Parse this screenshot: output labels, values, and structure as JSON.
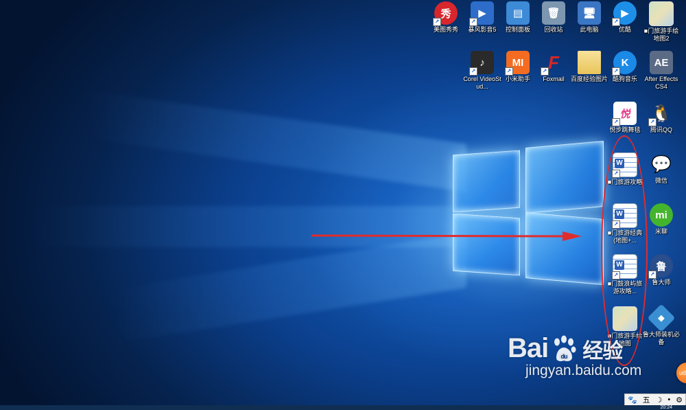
{
  "desktop": {
    "icons": [
      {
        "label": "美图秀秀",
        "glyph": "秀",
        "icon": "meitu-icon",
        "color": "#d7262c"
      },
      {
        "label": "暴风影音5",
        "glyph": "▶",
        "icon": "baofeng-icon",
        "color": "#2d6cc9"
      },
      {
        "label": "控制面板",
        "glyph": "▤",
        "icon": "control-panel-icon",
        "color": "#3d8ad6"
      },
      {
        "label": "回收站",
        "glyph": "🗑",
        "icon": "recycle-bin-icon",
        "color": "#7e97b0"
      },
      {
        "label": "此电脑",
        "glyph": "🖥",
        "icon": "this-pc-icon",
        "color": "#3a76c4"
      },
      {
        "label": "优酷",
        "glyph": "▶",
        "icon": "youku-icon",
        "color": "#1e8fe8"
      },
      {
        "label": "■门旅游手绘地图2",
        "glyph": "",
        "icon": "map-image-icon",
        "color": "#cfe3c5"
      },
      {
        "label": "Corel VideoStud...",
        "glyph": "♪",
        "icon": "corel-videostudio-icon",
        "color": "#2a2a2a"
      },
      {
        "label": "小米助手",
        "glyph": "MI",
        "icon": "xiaomi-assistant-icon",
        "color": "#f36c21"
      },
      {
        "label": "Foxmail",
        "glyph": "F",
        "icon": "foxmail-icon",
        "color": "#d92626"
      },
      {
        "label": "百度经验图片",
        "glyph": "",
        "icon": "folder-icon",
        "color": "#f4d77a"
      },
      {
        "label": "酷狗音乐",
        "glyph": "K",
        "icon": "kugou-icon",
        "color": "#1b8ae6"
      },
      {
        "label": "After Effects CS4",
        "glyph": "AE",
        "icon": "after-effects-icon",
        "color": "#5b6b86"
      },
      {
        "label": "悦步跳舞毯",
        "glyph": "悦",
        "icon": "dance-mat-icon",
        "color": "#e23d8a"
      },
      {
        "label": "腾讯QQ",
        "glyph": "🐧",
        "icon": "qq-icon",
        "color": "#1f1f1f"
      },
      {
        "label": "■门旅游攻略",
        "glyph": "W",
        "icon": "word-document-icon",
        "color": "#2b5fb3"
      },
      {
        "label": "微信",
        "glyph": "💬",
        "icon": "wechat-icon",
        "color": "#3fb53f"
      },
      {
        "label": "■门旅游经典(地图+...",
        "glyph": "W",
        "icon": "word-document-icon",
        "color": "#2b5fb3"
      },
      {
        "label": "米聊",
        "glyph": "mi",
        "icon": "miliao-icon",
        "color": "#45b42d"
      },
      {
        "label": "■门鼓浪屿旅游攻略...",
        "glyph": "W",
        "icon": "word-document-icon",
        "color": "#2b5fb3"
      },
      {
        "label": "鲁大师",
        "glyph": "鲁",
        "icon": "ludashi-icon",
        "color": "#2a4d8c"
      },
      {
        "label": "■门旅游手绘地图",
        "glyph": "",
        "icon": "map-image-icon",
        "color": "#cfe3c5"
      },
      {
        "label": "鲁大师装机必备",
        "glyph": "◆",
        "icon": "ludashi-install-icon",
        "color": "#3a8fd3"
      }
    ]
  },
  "watermark": {
    "brand_left": "Bai",
    "brand_right": "经验",
    "brand_mid": "du",
    "url": "jingyan.baidu.com"
  },
  "ime": {
    "mode": "五",
    "moon": "☽",
    "dot": "•",
    "gear": "⚙"
  },
  "floating_ball": {
    "label": "ud"
  },
  "clock": {
    "time": "20:24"
  },
  "colors": {
    "annotation": "#e12c2c",
    "desktop_bg": "#0b3f8c"
  }
}
